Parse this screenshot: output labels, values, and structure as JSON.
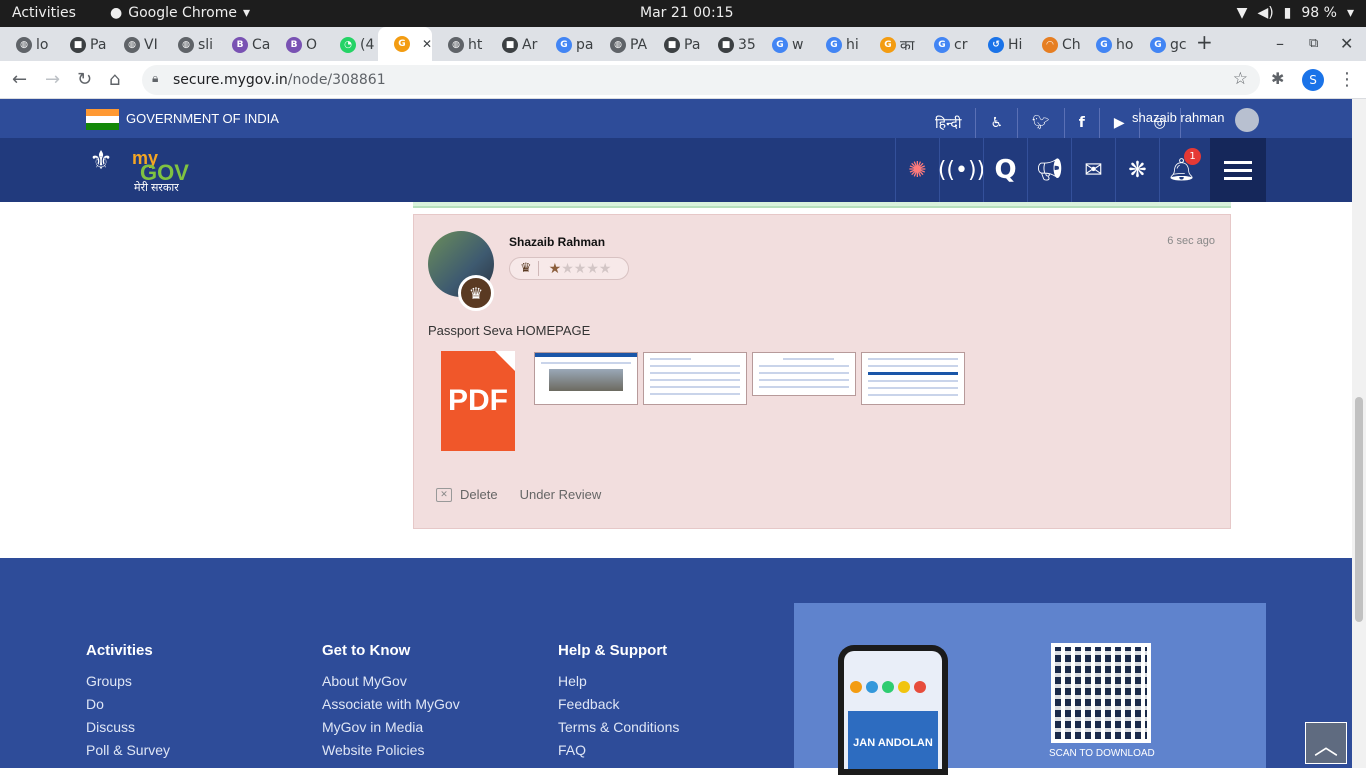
{
  "os": {
    "activities": "Activities",
    "app_name": "Google Chrome",
    "clock": "Mar 21  00:15",
    "battery": "98 %"
  },
  "browser": {
    "tabs": [
      {
        "label": "lo",
        "icon": "globe-icon"
      },
      {
        "label": "Pa",
        "icon": "site-icon"
      },
      {
        "label": "VI",
        "icon": "globe-icon"
      },
      {
        "label": "sli",
        "icon": "globe-icon"
      },
      {
        "label": "Ca",
        "icon": "bootstrap-icon"
      },
      {
        "label": "O",
        "icon": "bootstrap-icon"
      },
      {
        "label": "(4",
        "icon": "whatsapp-icon"
      },
      {
        "label": "",
        "icon": "mygov-icon"
      },
      {
        "label": "ht",
        "icon": "globe-icon"
      },
      {
        "label": "Ar",
        "icon": "site-icon"
      },
      {
        "label": "pa",
        "icon": "google-icon"
      },
      {
        "label": "PA",
        "icon": "globe-icon"
      },
      {
        "label": "Pa",
        "icon": "site-icon"
      },
      {
        "label": "35",
        "icon": "site-icon"
      },
      {
        "label": "w",
        "icon": "google-icon"
      },
      {
        "label": "hi",
        "icon": "google-icon"
      },
      {
        "label": "का",
        "icon": "mygov-icon"
      },
      {
        "label": "cr",
        "icon": "google-icon"
      },
      {
        "label": "Hi",
        "icon": "history-icon"
      },
      {
        "label": "Ch",
        "icon": "rainbow-icon"
      },
      {
        "label": "ho",
        "icon": "google-icon"
      },
      {
        "label": "gc",
        "icon": "google-icon"
      }
    ],
    "new_tab": "+",
    "url_host": "secure.mygov.in",
    "url_path": "/node/308861",
    "profile_initial": "S"
  },
  "site": {
    "gov_label": "GOVERNMENT OF INDIA",
    "lang_link": "हिन्दी",
    "user_name": "shazaib rahman",
    "logo_my": "my",
    "logo_gov": "GOV",
    "logo_sarkar": "मेरी सरकार",
    "notif_count": "1"
  },
  "comment": {
    "author": "Shazaib Rahman",
    "time": "6 sec ago",
    "text": "Passport Seva HOMEPAGE",
    "pdf_label": "PDF",
    "rating": 1,
    "rating_max": 5,
    "delete_label": "Delete",
    "status": "Under Review"
  },
  "footer": {
    "cols": [
      {
        "title": "Activities",
        "links": [
          "Groups",
          "Do",
          "Discuss",
          "Poll & Survey"
        ]
      },
      {
        "title": "Get to Know",
        "links": [
          "About MyGov",
          "Associate with MyGov",
          "MyGov in Media",
          "Website Policies"
        ]
      },
      {
        "title": "Help & Support",
        "links": [
          "Help",
          "Feedback",
          "Terms & Conditions",
          "FAQ"
        ]
      }
    ],
    "app_banner": "JAN ANDOLAN",
    "scan_label": "SCAN TO DOWNLOAD"
  },
  "colors": {
    "header_blue": "#2e4c99",
    "nav_blue": "#213a7d",
    "comment_bg": "#f2dede",
    "pdf_orange": "#f0572a"
  }
}
